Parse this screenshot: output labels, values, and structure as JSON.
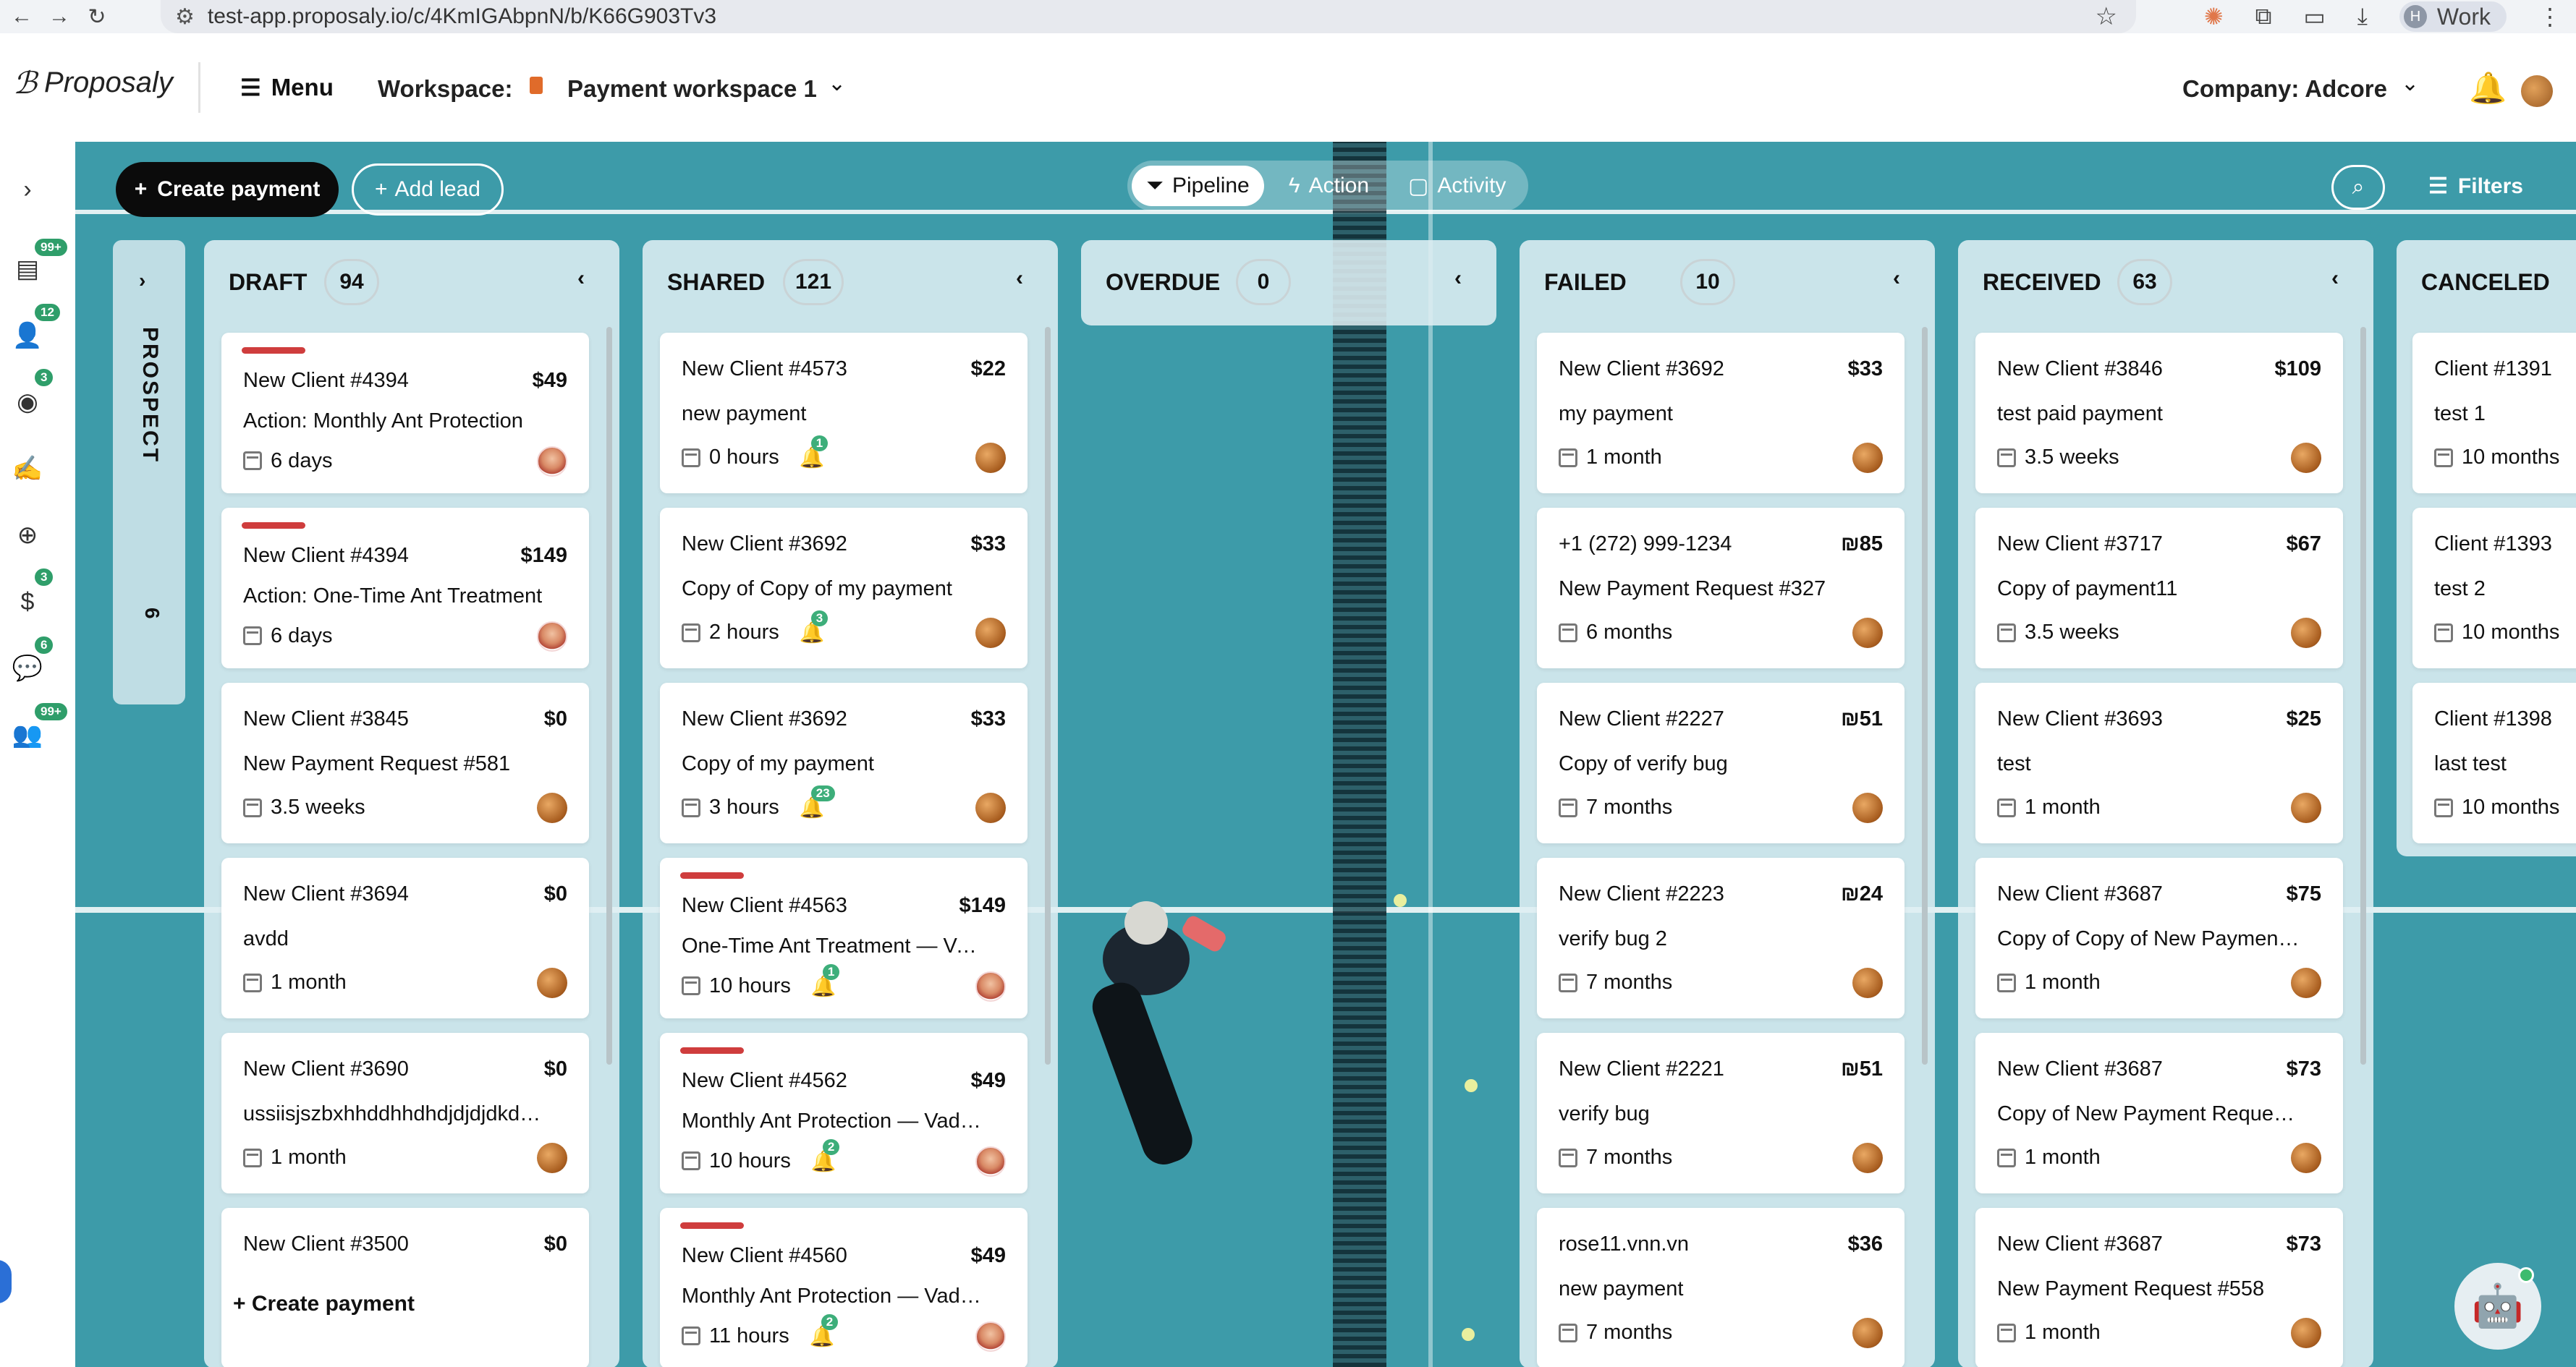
{
  "browser": {
    "url": "test-app.proposaly.io/c/4KmIGAbpnN/b/K66G903Tv3",
    "profile_initial": "H",
    "profile_label": "Work"
  },
  "header": {
    "brand": "Proposaly",
    "menu_label": "Menu",
    "workspace_label": "Workspace:",
    "workspace_name": "Payment workspace 1",
    "company_label": "Company: Adcore"
  },
  "sidebar": {
    "badges": [
      "99+",
      "12",
      "3",
      "3",
      "6",
      "99+"
    ]
  },
  "toolbar": {
    "create_payment": "Create payment",
    "add_lead": "Add lead",
    "tabs": [
      "Pipeline",
      "Action",
      "Activity"
    ],
    "filters": "Filters"
  },
  "prospect": {
    "label": "PROSPECT",
    "count": "6"
  },
  "columns": [
    {
      "title": "DRAFT",
      "count": "94",
      "footer": "+ Create payment",
      "cards": [
        {
          "client": "New Client #4394",
          "amount": "$49",
          "desc": "Action: Monthly Ant Protection",
          "time": "6 days",
          "red": true
        },
        {
          "client": "New Client #4394",
          "amount": "$149",
          "desc": "Action: One-Time Ant Treatment",
          "time": "6 days",
          "red": true
        },
        {
          "client": "New Client #3845",
          "amount": "$0",
          "desc": "New Payment Request #581",
          "time": "3.5 weeks"
        },
        {
          "client": "New Client #3694",
          "amount": "$0",
          "desc": "avdd",
          "time": "1 month"
        },
        {
          "client": "New Client #3690",
          "amount": "$0",
          "desc": "ussiisjszbxhhddhhdhdjdjdjdkdkd...",
          "time": "1 month"
        },
        {
          "client": "New Client #3500",
          "amount": "$0",
          "desc": "",
          "time": ""
        }
      ]
    },
    {
      "title": "SHARED",
      "count": "121",
      "cards": [
        {
          "client": "New Client #4573",
          "amount": "$22",
          "desc": "new payment",
          "time": "0 hours",
          "notif": "1"
        },
        {
          "client": "New Client #3692",
          "amount": "$33",
          "desc": "Copy of Copy of my payment",
          "time": "2 hours",
          "notif": "3"
        },
        {
          "client": "New Client #3692",
          "amount": "$33",
          "desc": "Copy of my payment",
          "time": "3 hours",
          "notif": "23"
        },
        {
          "client": "New Client #4563",
          "amount": "$149",
          "desc": "One-Time Ant Treatment — Vadi...",
          "time": "10 hours",
          "notif": "1",
          "red": true
        },
        {
          "client": "New Client #4562",
          "amount": "$49",
          "desc": "Monthly Ant Protection — Vadim ...",
          "time": "10 hours",
          "notif": "2",
          "red": true
        },
        {
          "client": "New Client #4560",
          "amount": "$49",
          "desc": "Monthly Ant Protection — Vadim ...",
          "time": "11 hours",
          "notif": "2",
          "red": true
        }
      ]
    },
    {
      "title": "OVERDUE",
      "count": "0",
      "cards": []
    },
    {
      "title": "FAILED",
      "count": "10",
      "cards": [
        {
          "client": "New Client #3692",
          "amount": "$33",
          "desc": "my payment",
          "time": "1 month"
        },
        {
          "client": "+1 (272) 999-1234",
          "amount": "₪85",
          "desc": "New Payment Request #327",
          "time": "6 months"
        },
        {
          "client": "New Client #2227",
          "amount": "₪51",
          "desc": "Copy of verify bug",
          "time": "7 months"
        },
        {
          "client": "New Client #2223",
          "amount": "₪24",
          "desc": "verify bug 2",
          "time": "7 months"
        },
        {
          "client": "New Client #2221",
          "amount": "₪51",
          "desc": "verify bug",
          "time": "7 months"
        },
        {
          "client": "rose11.vnn.vn",
          "amount": "$36",
          "desc": "new payment",
          "time": "7 months"
        }
      ]
    },
    {
      "title": "RECEIVED",
      "count": "63",
      "cards": [
        {
          "client": "New Client #3846",
          "amount": "$109",
          "desc": "test paid payment",
          "time": "3.5 weeks"
        },
        {
          "client": "New Client #3717",
          "amount": "$67",
          "desc": "Copy of payment11",
          "time": "3.5 weeks"
        },
        {
          "client": "New Client #3693",
          "amount": "$25",
          "desc": "test",
          "time": "1 month"
        },
        {
          "client": "New Client #3687",
          "amount": "$75",
          "desc": "Copy of Copy of New Payment R...",
          "time": "1 month"
        },
        {
          "client": "New Client #3687",
          "amount": "$73",
          "desc": "Copy of New Payment Request ...",
          "time": "1 month"
        },
        {
          "client": "New Client #3687",
          "amount": "$73",
          "desc": "New Payment Request #558",
          "time": "1 month"
        }
      ]
    },
    {
      "title": "CANCELED",
      "count": "",
      "cards": [
        {
          "client": "Client #1391",
          "amount": "",
          "desc": "test 1",
          "time": "10 months"
        },
        {
          "client": "Client #1393",
          "amount": "",
          "desc": "test 2",
          "time": "10 months"
        },
        {
          "client": "Client #1398",
          "amount": "",
          "desc": "last test",
          "time": "10 months"
        }
      ]
    }
  ],
  "colors": {
    "primary_button": "#0b0b0b",
    "badge_green": "#2f9e6a",
    "red_tag": "#cf3d3d",
    "board_bg": "#3d9ba9"
  }
}
